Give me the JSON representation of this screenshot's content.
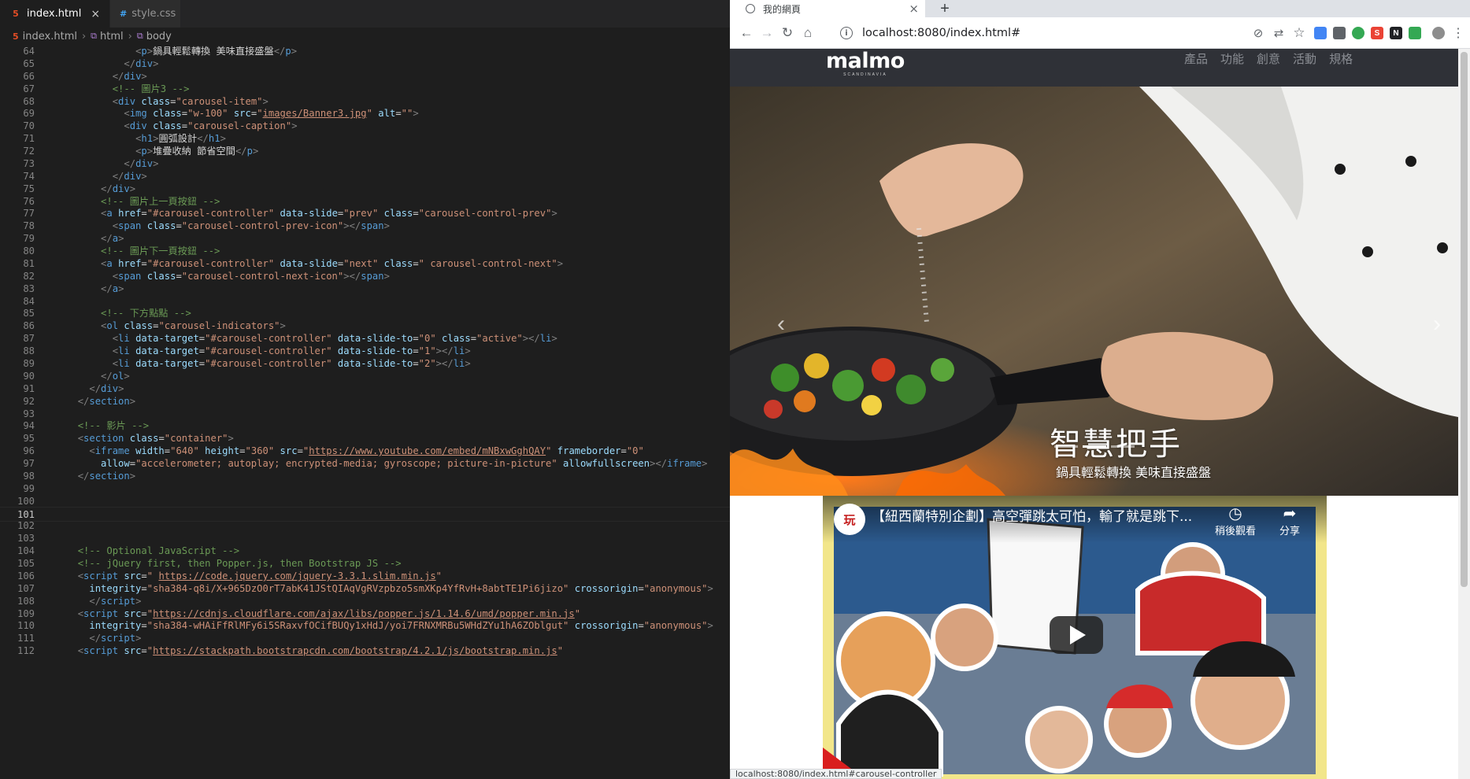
{
  "editor": {
    "tabs": [
      {
        "label": "index.html",
        "active": true
      },
      {
        "label": "style.css",
        "active": false
      }
    ],
    "breadcrumb": [
      "index.html",
      "html",
      "body"
    ],
    "current_line": 101,
    "lines": [
      {
        "n": "64",
        "html": "            <span class='p'>&lt;</span><span class='t'>p</span><span class='p'>&gt;</span><span class='x'>鍋具輕鬆轉換 美味直接盛盤</span><span class='p'>&lt;/</span><span class='t'>p</span><span class='p'>&gt;</span>"
      },
      {
        "n": "65",
        "html": "          <span class='p'>&lt;/</span><span class='t'>div</span><span class='p'>&gt;</span>"
      },
      {
        "n": "66",
        "html": "        <span class='p'>&lt;/</span><span class='t'>div</span><span class='p'>&gt;</span>"
      },
      {
        "n": "67",
        "html": "        <span class='c'>&lt;!-- 圖片3 --&gt;</span>"
      },
      {
        "n": "68",
        "html": "        <span class='p'>&lt;</span><span class='t'>div</span> <span class='a'>class</span><span class='x'>=</span><span class='s'>\"carousel-item\"</span><span class='p'>&gt;</span>"
      },
      {
        "n": "69",
        "html": "          <span class='p'>&lt;</span><span class='t'>img</span> <span class='a'>class</span><span class='x'>=</span><span class='s'>\"w-100\"</span> <span class='a'>src</span><span class='x'>=</span><span class='s'>\"</span><span class='su'>images/Banner3.jpg</span><span class='s'>\"</span> <span class='a'>alt</span><span class='x'>=</span><span class='s'>\"\"</span><span class='p'>&gt;</span>"
      },
      {
        "n": "70",
        "html": "          <span class='p'>&lt;</span><span class='t'>div</span> <span class='a'>class</span><span class='x'>=</span><span class='s'>\"carousel-caption\"</span><span class='p'>&gt;</span>"
      },
      {
        "n": "71",
        "html": "            <span class='p'>&lt;</span><span class='t'>h1</span><span class='p'>&gt;</span><span class='x'>圓弧設計</span><span class='p'>&lt;/</span><span class='t'>h1</span><span class='p'>&gt;</span>"
      },
      {
        "n": "72",
        "html": "            <span class='p'>&lt;</span><span class='t'>p</span><span class='p'>&gt;</span><span class='x'>堆疊收納 節省空間</span><span class='p'>&lt;/</span><span class='t'>p</span><span class='p'>&gt;</span>"
      },
      {
        "n": "73",
        "html": "          <span class='p'>&lt;/</span><span class='t'>div</span><span class='p'>&gt;</span>"
      },
      {
        "n": "74",
        "html": "        <span class='p'>&lt;/</span><span class='t'>div</span><span class='p'>&gt;</span>"
      },
      {
        "n": "75",
        "html": "      <span class='p'>&lt;/</span><span class='t'>div</span><span class='p'>&gt;</span>"
      },
      {
        "n": "76",
        "html": "      <span class='c'>&lt;!-- 圖片上一頁按鈕 --&gt;</span>"
      },
      {
        "n": "77",
        "html": "      <span class='p'>&lt;</span><span class='t'>a</span> <span class='a'>href</span><span class='x'>=</span><span class='s'>\"#carousel-controller\"</span> <span class='a'>data-slide</span><span class='x'>=</span><span class='s'>\"prev\"</span> <span class='a'>class</span><span class='x'>=</span><span class='s'>\"carousel-control-prev\"</span><span class='p'>&gt;</span>"
      },
      {
        "n": "78",
        "html": "        <span class='p'>&lt;</span><span class='t'>span</span> <span class='a'>class</span><span class='x'>=</span><span class='s'>\"carousel-control-prev-icon\"</span><span class='p'>&gt;&lt;/</span><span class='t'>span</span><span class='p'>&gt;</span>"
      },
      {
        "n": "79",
        "html": "      <span class='p'>&lt;/</span><span class='t'>a</span><span class='p'>&gt;</span>"
      },
      {
        "n": "80",
        "html": "      <span class='c'>&lt;!-- 圖片下一頁按鈕 --&gt;</span>"
      },
      {
        "n": "81",
        "html": "      <span class='p'>&lt;</span><span class='t'>a</span> <span class='a'>href</span><span class='x'>=</span><span class='s'>\"#carousel-controller\"</span> <span class='a'>data-slide</span><span class='x'>=</span><span class='s'>\"next\"</span> <span class='a'>class</span><span class='x'>=</span><span class='s'>\" carousel-control-next\"</span><span class='p'>&gt;</span>"
      },
      {
        "n": "82",
        "html": "        <span class='p'>&lt;</span><span class='t'>span</span> <span class='a'>class</span><span class='x'>=</span><span class='s'>\"carousel-control-next-icon\"</span><span class='p'>&gt;&lt;/</span><span class='t'>span</span><span class='p'>&gt;</span>"
      },
      {
        "n": "83",
        "html": "      <span class='p'>&lt;/</span><span class='t'>a</span><span class='p'>&gt;</span>"
      },
      {
        "n": "84",
        "html": ""
      },
      {
        "n": "85",
        "html": "      <span class='c'>&lt;!-- 下方點點 --&gt;</span>"
      },
      {
        "n": "86",
        "html": "      <span class='p'>&lt;</span><span class='t'>ol</span> <span class='a'>class</span><span class='x'>=</span><span class='s'>\"carousel-indicators\"</span><span class='p'>&gt;</span>"
      },
      {
        "n": "87",
        "html": "        <span class='p'>&lt;</span><span class='t'>li</span> <span class='a'>data-target</span><span class='x'>=</span><span class='s'>\"#carousel-controller\"</span> <span class='a'>data-slide-to</span><span class='x'>=</span><span class='s'>\"0\"</span> <span class='a'>class</span><span class='x'>=</span><span class='s'>\"active\"</span><span class='p'>&gt;&lt;/</span><span class='t'>li</span><span class='p'>&gt;</span>"
      },
      {
        "n": "88",
        "html": "        <span class='p'>&lt;</span><span class='t'>li</span> <span class='a'>data-target</span><span class='x'>=</span><span class='s'>\"#carousel-controller\"</span> <span class='a'>data-slide-to</span><span class='x'>=</span><span class='s'>\"1\"</span><span class='p'>&gt;&lt;/</span><span class='t'>li</span><span class='p'>&gt;</span>"
      },
      {
        "n": "89",
        "html": "        <span class='p'>&lt;</span><span class='t'>li</span> <span class='a'>data-target</span><span class='x'>=</span><span class='s'>\"#carousel-controller\"</span> <span class='a'>data-slide-to</span><span class='x'>=</span><span class='s'>\"2\"</span><span class='p'>&gt;&lt;/</span><span class='t'>li</span><span class='p'>&gt;</span>"
      },
      {
        "n": "90",
        "html": "      <span class='p'>&lt;/</span><span class='t'>ol</span><span class='p'>&gt;</span>"
      },
      {
        "n": "91",
        "html": "    <span class='p'>&lt;/</span><span class='t'>div</span><span class='p'>&gt;</span>"
      },
      {
        "n": "92",
        "html": "  <span class='p'>&lt;/</span><span class='t'>section</span><span class='p'>&gt;</span>"
      },
      {
        "n": "93",
        "html": ""
      },
      {
        "n": "94",
        "html": "  <span class='c'>&lt;!-- 影片 --&gt;</span>"
      },
      {
        "n": "95",
        "html": "  <span class='p'>&lt;</span><span class='t'>section</span> <span class='a'>class</span><span class='x'>=</span><span class='s'>\"container\"</span><span class='p'>&gt;</span>"
      },
      {
        "n": "96",
        "html": "    <span class='p'>&lt;</span><span class='t'>iframe</span> <span class='a'>width</span><span class='x'>=</span><span class='s'>\"640\"</span> <span class='a'>height</span><span class='x'>=</span><span class='s'>\"360\"</span> <span class='a'>src</span><span class='x'>=</span><span class='s'>\"</span><span class='su'>https://www.youtube.com/embed/mNBxwGghQAY</span><span class='s'>\"</span> <span class='a'>frameborder</span><span class='x'>=</span><span class='s'>\"0\"</span>"
      },
      {
        "n": "97",
        "html": "      <span class='a'>allow</span><span class='x'>=</span><span class='s'>\"accelerometer; autoplay; encrypted-media; gyroscope; picture-in-picture\"</span> <span class='a'>allowfullscreen</span><span class='p'>&gt;&lt;/</span><span class='t'>iframe</span><span class='p'>&gt;</span>"
      },
      {
        "n": "98",
        "html": "  <span class='p'>&lt;/</span><span class='t'>section</span><span class='p'>&gt;</span>"
      },
      {
        "n": "99",
        "html": ""
      },
      {
        "n": "100",
        "html": ""
      },
      {
        "n": "101",
        "html": ""
      },
      {
        "n": "102",
        "html": ""
      },
      {
        "n": "103",
        "html": ""
      },
      {
        "n": "104",
        "html": "  <span class='c'>&lt;!-- Optional JavaScript --&gt;</span>"
      },
      {
        "n": "105",
        "html": "  <span class='c'>&lt;!-- jQuery first, then Popper.js, then Bootstrap JS --&gt;</span>"
      },
      {
        "n": "106",
        "html": "  <span class='p'>&lt;</span><span class='t'>script</span> <span class='a'>src</span><span class='x'>=</span><span class='s'>\" </span><span class='su'>https://code.jquery.com/jquery-3.3.1.slim.min.js</span><span class='s'>\"</span>"
      },
      {
        "n": "107",
        "html": "    <span class='a'>integrity</span><span class='x'>=</span><span class='s'>\"sha384-q8i/X+965DzO0rT7abK41JStQIAqVgRVzpbzo5smXKp4YfRvH+8abtTE1Pi6jizo\"</span> <span class='a'>crossorigin</span><span class='x'>=</span><span class='s'>\"anonymous\"</span><span class='p'>&gt;</span>"
      },
      {
        "n": "108",
        "html": "    <span class='p'>&lt;/</span><span class='t'>script</span><span class='p'>&gt;</span>"
      },
      {
        "n": "109",
        "html": "  <span class='p'>&lt;</span><span class='t'>script</span> <span class='a'>src</span><span class='x'>=</span><span class='s'>\"</span><span class='su'>https://cdnjs.cloudflare.com/ajax/libs/popper.js/1.14.6/umd/popper.min.js</span><span class='s'>\"</span>"
      },
      {
        "n": "110",
        "html": "    <span class='a'>integrity</span><span class='x'>=</span><span class='s'>\"sha384-wHAiFfRlMFy6i5SRaxvfOCifBUQy1xHdJ/yoi7FRNXMRBu5WHdZYu1hA6ZOblgut\"</span> <span class='a'>crossorigin</span><span class='x'>=</span><span class='s'>\"anonymous\"</span><span class='p'>&gt;</span>"
      },
      {
        "n": "111",
        "html": "    <span class='p'>&lt;/</span><span class='t'>script</span><span class='p'>&gt;</span>"
      },
      {
        "n": "112",
        "html": "  <span class='p'>&lt;</span><span class='t'>script</span> <span class='a'>src</span><span class='x'>=</span><span class='s'>\"</span><span class='su'>https://stackpath.bootstrapcdn.com/bootstrap/4.2.1/js/bootstrap.min.js</span><span class='s'>\"</span>"
      }
    ]
  },
  "browser": {
    "tab_title": "我的網頁",
    "new_tab_label": "+",
    "url": "localhost:8080/index.html#",
    "status_url": "localhost:8080/index.html#carousel-controller",
    "ext_colors": [
      "#4285f4",
      "#5f6368",
      "#34a853",
      "#ea4335",
      "#202124",
      "#34a853"
    ]
  },
  "site": {
    "logo_main": "malmo",
    "logo_sub": "SCANDINAVIA",
    "menu": [
      "產品",
      "功能",
      "創意",
      "活動",
      "規格"
    ],
    "carousel": {
      "caption_title": "智慧把手",
      "caption_text": "鍋具輕鬆轉換 美味直接盛盤",
      "prev_glyph": "‹",
      "next_glyph": "›",
      "indicator_count": 3,
      "active_index": 1
    },
    "video": {
      "title": "【紐西蘭特別企劃】高空彈跳太可怕，輸了就是跳下...",
      "channel_badge": "玩",
      "watch_later": "稍後觀看",
      "share": "分享"
    }
  }
}
